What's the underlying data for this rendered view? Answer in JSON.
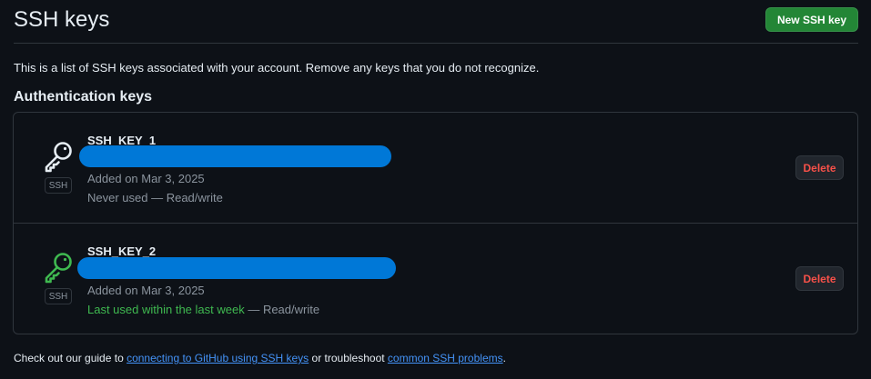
{
  "header": {
    "title": "SSH keys",
    "new_key_label": "New SSH key"
  },
  "intro": "This is a list of SSH keys associated with your account. Remove any keys that you do not recognize.",
  "section_title": "Authentication keys",
  "keys": [
    {
      "name": "SSH_KEY_1",
      "badge": "SSH",
      "icon": "key-icon",
      "icon_color": "#e6edf3",
      "added": "Added on Mar 3, 2025",
      "usage": "Never used",
      "usage_color": "#8b949e",
      "access": " — Read/write",
      "delete_label": "Delete"
    },
    {
      "name": "SSH_KEY_2",
      "badge": "SSH",
      "icon": "key-icon",
      "icon_color": "#3fb950",
      "added": "Added on Mar 3, 2025",
      "usage": "Last used within the last week",
      "usage_color": "#3fb950",
      "access": " — Read/write",
      "delete_label": "Delete"
    }
  ],
  "footer": {
    "prefix": "Check out our guide to ",
    "link1": "connecting to GitHub using SSH keys",
    "middle": " or troubleshoot ",
    "link2": "common SSH problems",
    "suffix": "."
  },
  "colors": {
    "background": "#0d1117",
    "accent_green": "#238636",
    "danger": "#f85149",
    "link": "#4493f8",
    "redaction": "#0078d7"
  }
}
